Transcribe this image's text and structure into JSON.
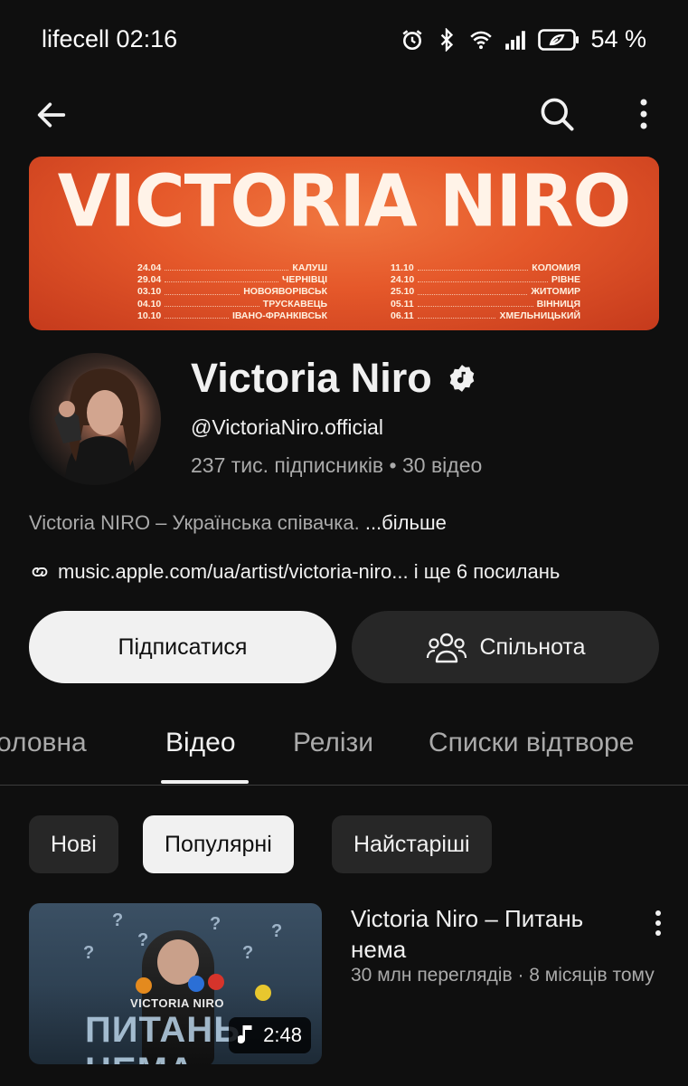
{
  "status_bar": {
    "carrier": "lifecell",
    "time": "02:16",
    "battery": "54 %"
  },
  "channel": {
    "banner_title": "VICTORIA NIRO",
    "tour_left": [
      {
        "date": "24.04",
        "city": "КАЛУШ"
      },
      {
        "date": "29.04",
        "city": "ЧЕРНІВЦІ"
      },
      {
        "date": "03.10",
        "city": "НОВОЯВОРІВСЬК"
      },
      {
        "date": "04.10",
        "city": "ТРУСКАВЕЦЬ"
      },
      {
        "date": "10.10",
        "city": "ІВАНО-ФРАНКІВСЬК"
      }
    ],
    "tour_right": [
      {
        "date": "11.10",
        "city": "КОЛОМИЯ"
      },
      {
        "date": "24.10",
        "city": "РІВНЕ"
      },
      {
        "date": "25.10",
        "city": "ЖИТОМИР"
      },
      {
        "date": "05.11",
        "city": "ВІННИЦЯ"
      },
      {
        "date": "06.11",
        "city": "ХМЕЛЬНИЦЬКИЙ"
      }
    ],
    "name": "Victoria Niro",
    "handle": "@VictoriaNiro.official",
    "stats": "237 тис. підписників • 30 відео",
    "description": "Victoria NIRO – Українська співачка.",
    "description_more": " ...більше",
    "link": "music.apple.com/ua/artist/victoria-niro...",
    "link_more": " і ще 6 посилань"
  },
  "buttons": {
    "subscribe": "Підписатися",
    "community": "Спільнота"
  },
  "tabs": [
    "оловна",
    "Відео",
    "Релізи",
    "Списки відтворе"
  ],
  "chips": [
    "Нові",
    "Популярні",
    "Найстаріші"
  ],
  "video": {
    "thumb_artist": "VICTORIA NIRO",
    "thumb_title": "ПИТАНЬ НЕМА",
    "duration": "2:48",
    "title": "Victoria Niro – Питань нема",
    "meta": "30 млн переглядів · 8 місяців тому"
  },
  "colors": {
    "background": "#0f0f0f",
    "text_primary": "#f1f1f1",
    "text_secondary": "#aaaaaa",
    "chip_bg": "#272727",
    "banner_orange": "#e5582a"
  }
}
